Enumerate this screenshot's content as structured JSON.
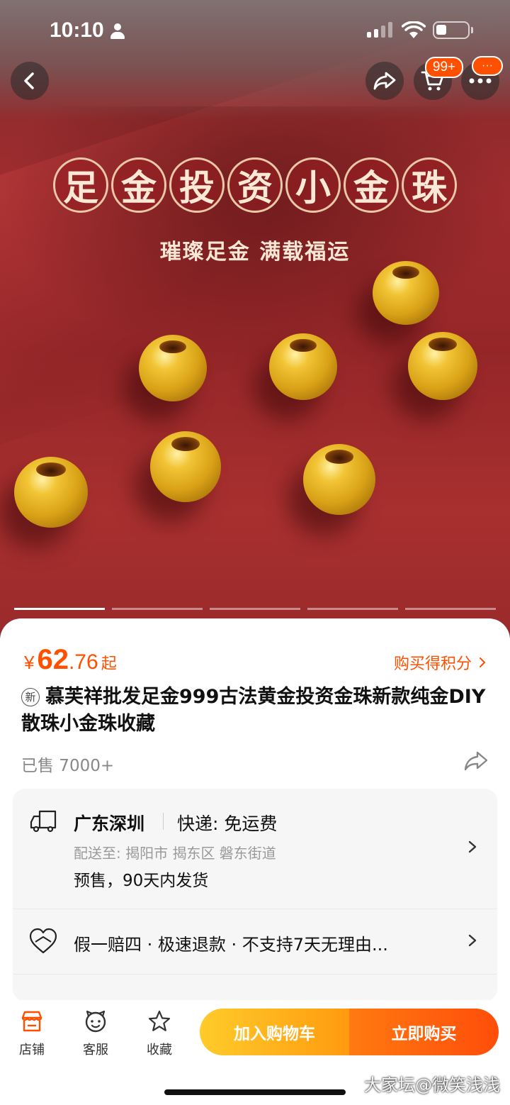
{
  "status_bar": {
    "time": "10:10"
  },
  "nav": {
    "cart_badge": "99+",
    "more_badge": "···"
  },
  "hero": {
    "headline_chars": [
      "足",
      "金",
      "投",
      "资",
      "小",
      "金",
      "珠"
    ],
    "subhead": "璀璨足金 满载福运",
    "carousel": {
      "total_slides": 5,
      "active_index": 0
    }
  },
  "product": {
    "price_symbol": "¥",
    "price_integer": "62",
    "price_decimal": ".76",
    "price_suffix": "起",
    "points_label": "购买得积分",
    "new_tag": "新",
    "title": "慕芙祥批发足金999古法黄金投资金珠新款纯金DIY散珠小金珠收藏",
    "sold": "已售 7000+"
  },
  "shipping": {
    "origin": "广东深圳",
    "method": "快递: 免运费",
    "destination": "配送至: 揭阳市 揭东区 磐东街道",
    "presale": "预售，90天内发货"
  },
  "guarantee": {
    "text": "假一赔四 · 极速退款 · 不支持7天无理由..."
  },
  "bottom_bar": {
    "shop": "店铺",
    "service": "客服",
    "favorite": "收藏",
    "add_to_cart": "加入购物车",
    "buy_now": "立即购买"
  },
  "watermark": "大家坛@微笑浅浅",
  "colors": {
    "accent": "#ff5000",
    "cart_button": "#ffb41c",
    "buy_button": "#ff5e0e"
  }
}
